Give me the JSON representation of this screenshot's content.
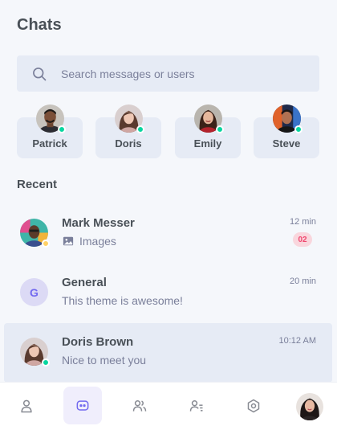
{
  "title": "Chats",
  "search": {
    "placeholder": "Search messages or users"
  },
  "online_users": [
    {
      "name": "Patrick",
      "avatar": "avatar-patrick"
    },
    {
      "name": "Doris",
      "avatar": "avatar-doris"
    },
    {
      "name": "Emily",
      "avatar": "avatar-emily"
    },
    {
      "name": "Steve",
      "avatar": "avatar-steve"
    }
  ],
  "recent_title": "Recent",
  "chats": [
    {
      "name": "Mark Messer",
      "message": "Images",
      "time": "12 min",
      "unread": "02",
      "status": "away",
      "attachment_icon": "image-icon"
    },
    {
      "name": "General",
      "message": "This theme is awesome!",
      "time": "20 min",
      "initial": "G"
    },
    {
      "name": "Doris Brown",
      "message": "Nice to meet you",
      "time": "10:12 AM",
      "status": "online",
      "active": true
    }
  ],
  "nav": {
    "items": [
      "profile-icon",
      "chats-icon",
      "groups-icon",
      "contacts-icon",
      "settings-icon"
    ],
    "active": "chats-icon"
  },
  "colors": {
    "accent": "#7269ef",
    "online": "#06d6a0",
    "away": "#ffd166",
    "badge_text": "#ef476f",
    "badge_bg": "#f9d6dd",
    "card_bg": "#e6ebf5"
  }
}
